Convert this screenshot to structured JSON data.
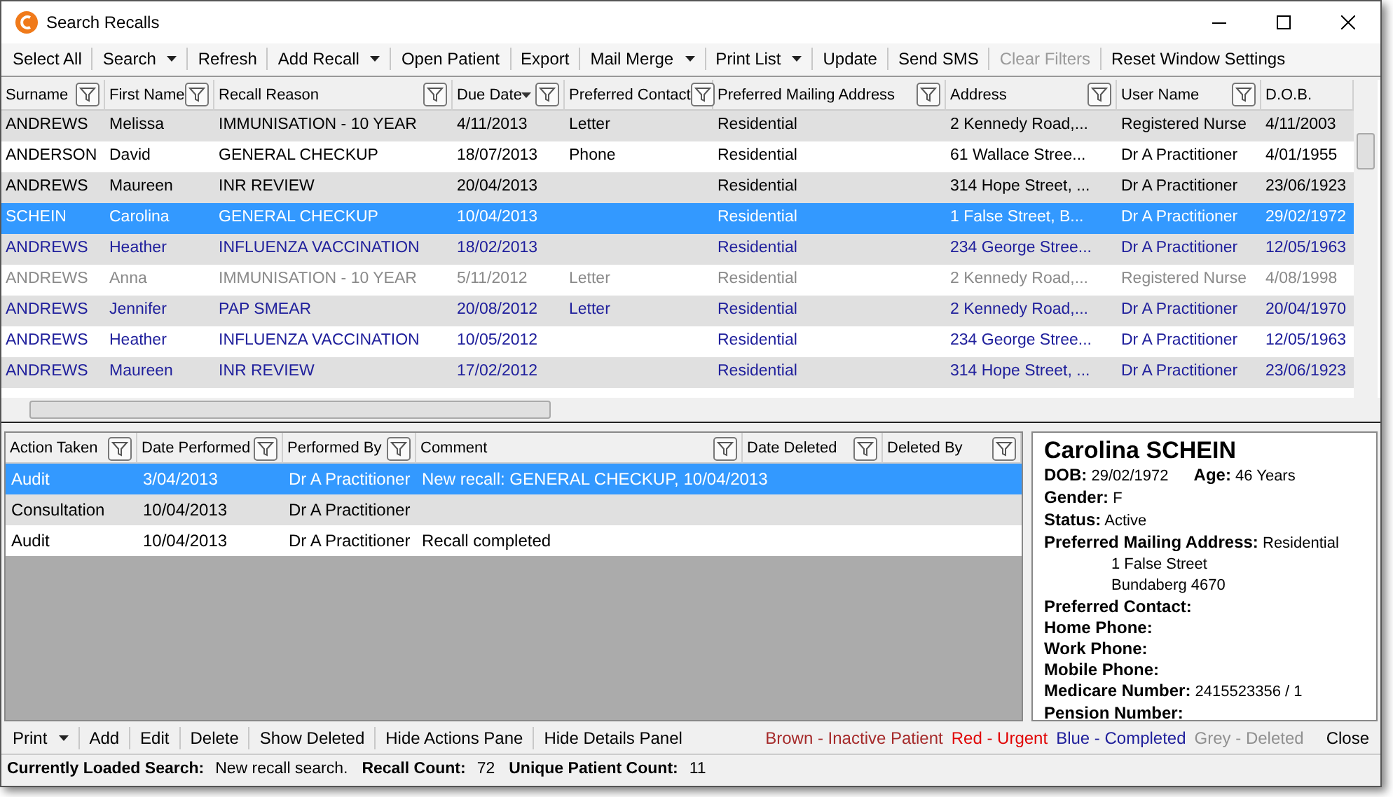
{
  "window": {
    "title": "Search Recalls"
  },
  "toolbar": [
    {
      "label": "Select All",
      "dropdown": false,
      "disabled": false
    },
    {
      "label": "Search",
      "dropdown": true,
      "disabled": false
    },
    {
      "label": "Refresh",
      "dropdown": false,
      "disabled": false
    },
    {
      "label": "Add Recall",
      "dropdown": true,
      "disabled": false
    },
    {
      "label": "Open Patient",
      "dropdown": false,
      "disabled": false
    },
    {
      "label": "Export",
      "dropdown": false,
      "disabled": false
    },
    {
      "label": "Mail Merge",
      "dropdown": true,
      "disabled": false
    },
    {
      "label": "Print List",
      "dropdown": true,
      "disabled": false
    },
    {
      "label": "Update",
      "dropdown": false,
      "disabled": false
    },
    {
      "label": "Send SMS",
      "dropdown": false,
      "disabled": false
    },
    {
      "label": "Clear Filters",
      "dropdown": false,
      "disabled": true
    },
    {
      "label": "Reset Window Settings",
      "dropdown": false,
      "disabled": false
    }
  ],
  "recalls": {
    "columns": [
      {
        "label": "Surname",
        "sorted": false
      },
      {
        "label": "First Name",
        "sorted": false
      },
      {
        "label": "Recall Reason",
        "sorted": false
      },
      {
        "label": "Due Date",
        "sorted": true
      },
      {
        "label": "Preferred Contact",
        "sorted": false
      },
      {
        "label": "Preferred Mailing Address",
        "sorted": false
      },
      {
        "label": "Address",
        "sorted": false
      },
      {
        "label": "User Name",
        "sorted": false
      },
      {
        "label": "D.O.B.",
        "sorted": false
      }
    ],
    "rows": [
      {
        "color": "#000000",
        "selected": false,
        "cells": [
          "ANDREWS",
          "Melissa",
          "IMMUNISATION - 10 YEAR",
          "4/11/2013",
          "Letter",
          "Residential",
          "2 Kennedy Road,...",
          "Registered Nurse",
          "4/11/2003"
        ]
      },
      {
        "color": "#000000",
        "selected": false,
        "cells": [
          "ANDERSON",
          "David",
          "GENERAL CHECKUP",
          "18/07/2013",
          "Phone",
          "Residential",
          "61 Wallace Stree...",
          "Dr A Practitioner",
          "4/01/1955"
        ]
      },
      {
        "color": "#000000",
        "selected": false,
        "cells": [
          "ANDREWS",
          "Maureen",
          "INR REVIEW",
          "20/04/2013",
          "",
          "Residential",
          "314 Hope Street, ...",
          "Dr A Practitioner",
          "23/06/1923"
        ]
      },
      {
        "selected": true,
        "cells": [
          "SCHEIN",
          "Carolina",
          "GENERAL CHECKUP",
          "10/04/2013",
          "",
          "Residential",
          "1 False Street,  B...",
          "Dr A Practitioner",
          "29/02/1972"
        ]
      },
      {
        "color": "#20209c",
        "selected": false,
        "cells": [
          "ANDREWS",
          "Heather",
          "INFLUENZA VACCINATION",
          "18/02/2013",
          "",
          "Residential",
          "234 George Stree...",
          "Dr A Practitioner",
          "12/05/1963"
        ]
      },
      {
        "color": "#8a8a8a",
        "selected": false,
        "cells": [
          "ANDREWS",
          "Anna",
          "IMMUNISATION - 10 YEAR",
          "5/11/2012",
          "Letter",
          "Residential",
          "2 Kennedy Road,...",
          "Registered Nurse",
          "4/08/1998"
        ]
      },
      {
        "color": "#20209c",
        "selected": false,
        "cells": [
          "ANDREWS",
          "Jennifer",
          "PAP SMEAR",
          "20/08/2012",
          "Letter",
          "Residential",
          "2 Kennedy Road,...",
          "Dr A Practitioner",
          "20/04/1970"
        ]
      },
      {
        "color": "#20209c",
        "selected": false,
        "cells": [
          "ANDREWS",
          "Heather",
          "INFLUENZA VACCINATION",
          "10/05/2012",
          "",
          "Residential",
          "234 George Stree...",
          "Dr A Practitioner",
          "12/05/1963"
        ]
      },
      {
        "color": "#20209c",
        "selected": false,
        "cells": [
          "ANDREWS",
          "Maureen",
          "INR REVIEW",
          "17/02/2012",
          "",
          "Residential",
          "314 Hope Street, ...",
          "Dr A Practitioner",
          "23/06/1923"
        ]
      }
    ]
  },
  "actions": {
    "columns": [
      {
        "label": "Action Taken"
      },
      {
        "label": "Date Performed"
      },
      {
        "label": "Performed By"
      },
      {
        "label": "Comment"
      },
      {
        "label": "Date Deleted"
      },
      {
        "label": "Deleted By"
      }
    ],
    "rows": [
      {
        "selected": true,
        "cells": [
          "Audit",
          "3/04/2013",
          "Dr A Practitioner",
          "New recall: GENERAL CHECKUP, 10/04/2013",
          "",
          ""
        ]
      },
      {
        "selected": false,
        "cells": [
          "Consultation",
          "10/04/2013",
          "Dr A Practitioner",
          "",
          "",
          ""
        ]
      },
      {
        "selected": false,
        "cells": [
          "Audit",
          "10/04/2013",
          "Dr A Practitioner",
          "Recall completed",
          "",
          ""
        ]
      }
    ]
  },
  "details": {
    "name": "Carolina SCHEIN",
    "lines": [
      {
        "kind": "fields",
        "fields": [
          {
            "label": "DOB:",
            "value": "29/02/1972"
          },
          {
            "label": "Age:",
            "value": "46 Years"
          }
        ]
      },
      {
        "kind": "fields",
        "fields": [
          {
            "label": "Gender:",
            "value": "F"
          }
        ]
      },
      {
        "kind": "fields",
        "fields": [
          {
            "label": "Status:",
            "value": "Active"
          }
        ]
      },
      {
        "kind": "fields",
        "fields": [
          {
            "label": "Preferred Mailing Address:",
            "value": "Residential"
          }
        ]
      },
      {
        "kind": "indent",
        "text": "1 False Street"
      },
      {
        "kind": "indent",
        "text": "Bundaberg 4670"
      },
      {
        "kind": "fields",
        "fields": [
          {
            "label": "Preferred Contact:"
          }
        ]
      },
      {
        "kind": "fields",
        "fields": [
          {
            "label": "Home Phone:"
          }
        ]
      },
      {
        "kind": "fields",
        "fields": [
          {
            "label": "Work Phone:"
          }
        ]
      },
      {
        "kind": "fields",
        "fields": [
          {
            "label": "Mobile Phone:"
          }
        ]
      },
      {
        "kind": "fields",
        "fields": [
          {
            "label": "Medicare Number:",
            "value": "2415523356 / 1"
          }
        ]
      },
      {
        "kind": "fields",
        "fields": [
          {
            "label": "Pension Number:"
          }
        ]
      }
    ]
  },
  "bottom_toolbar": [
    {
      "label": "Print",
      "dropdown": true
    },
    {
      "label": "Add",
      "dropdown": false
    },
    {
      "label": "Edit",
      "dropdown": false
    },
    {
      "label": "Delete",
      "dropdown": false
    },
    {
      "label": "Show Deleted",
      "dropdown": false
    },
    {
      "label": "Hide Actions Pane",
      "dropdown": false
    },
    {
      "label": "Hide Details Panel",
      "dropdown": false
    }
  ],
  "legend": [
    {
      "text": "Brown - Inactive Patient",
      "color": "#a52a2a"
    },
    {
      "text": "Red - Urgent",
      "color": "#e00000"
    },
    {
      "text": "Blue - Completed",
      "color": "#20209c"
    },
    {
      "text": "Grey - Deleted",
      "color": "#909090"
    }
  ],
  "close_button": "Close",
  "status_bar": [
    {
      "label": "Currently Loaded Search:",
      "value": "New recall search."
    },
    {
      "label": "Recall Count:",
      "value": "72"
    },
    {
      "label": "Unique Patient Count:",
      "value": "11"
    }
  ]
}
